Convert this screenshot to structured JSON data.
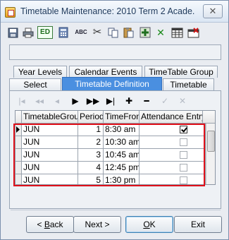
{
  "window": {
    "title": "Timetable Maintenance:  2010 Term 2 Acade...",
    "close_label": "✕"
  },
  "toolbar": {
    "buttons": [
      {
        "name": "save-icon"
      },
      {
        "name": "print-icon"
      },
      {
        "name": "edit-icon",
        "label": "ED"
      },
      {
        "name": "calculator-icon"
      },
      {
        "name": "spellcheck-icon",
        "label": "ABC"
      },
      {
        "name": "cut-icon",
        "label": "✂"
      },
      {
        "name": "copy-icon"
      },
      {
        "name": "paste-icon"
      },
      {
        "name": "add-record-icon"
      },
      {
        "name": "delete-record-icon",
        "label": "✕"
      },
      {
        "name": "grid-icon"
      },
      {
        "name": "cancel-edit-icon"
      }
    ]
  },
  "status_field": {
    "value": ""
  },
  "tabs": {
    "row_back": [
      "Year Levels",
      "Calendar Events",
      "TimeTable Group"
    ],
    "row_front": [
      "Select",
      "Timetable Definition",
      "Timetable"
    ],
    "active": "Timetable Definition"
  },
  "navigator": {
    "buttons": [
      {
        "name": "first-record-button",
        "glyph": "|◂",
        "enabled": false
      },
      {
        "name": "prior-page-button",
        "glyph": "◂◂",
        "enabled": false
      },
      {
        "name": "prior-record-button",
        "glyph": "◂",
        "enabled": false
      },
      {
        "name": "next-record-button",
        "glyph": "▶",
        "enabled": true
      },
      {
        "name": "next-page-button",
        "glyph": "▶▶",
        "enabled": true
      },
      {
        "name": "last-record-button",
        "glyph": "▶|",
        "enabled": true
      },
      {
        "name": "insert-record-button",
        "glyph": "✚",
        "enabled": true
      },
      {
        "name": "delete-record-button",
        "glyph": "━",
        "enabled": true
      },
      {
        "name": "post-edit-button",
        "glyph": "✓",
        "enabled": false
      },
      {
        "name": "cancel-edit-button",
        "glyph": "✕",
        "enabled": false
      }
    ]
  },
  "grid": {
    "columns": [
      "TimetableGroup",
      "Period",
      "TimeFrom",
      "Attendance Entry"
    ],
    "rows": [
      {
        "group": "JUN",
        "period": "1",
        "time_from": "8:30 am",
        "attendance": true,
        "current": true
      },
      {
        "group": "JUN",
        "period": "2",
        "time_from": "10:30 am",
        "attendance": false,
        "current": false
      },
      {
        "group": "JUN",
        "period": "3",
        "time_from": "10:45 am",
        "attendance": false,
        "current": false
      },
      {
        "group": "JUN",
        "period": "4",
        "time_from": "12:45 pm",
        "attendance": false,
        "current": false
      },
      {
        "group": "JUN",
        "period": "5",
        "time_from": "1:30 pm",
        "attendance": false,
        "current": false
      }
    ]
  },
  "footer": {
    "back": {
      "prefix": "< ",
      "accel": "B",
      "rest": "ack"
    },
    "next": {
      "label": "Next >"
    },
    "ok": {
      "accel": "O",
      "rest": "K"
    },
    "exit": {
      "label": "Exit"
    }
  },
  "colors": {
    "active_tab": "#4a8fe0",
    "highlight": "#e0101a"
  }
}
